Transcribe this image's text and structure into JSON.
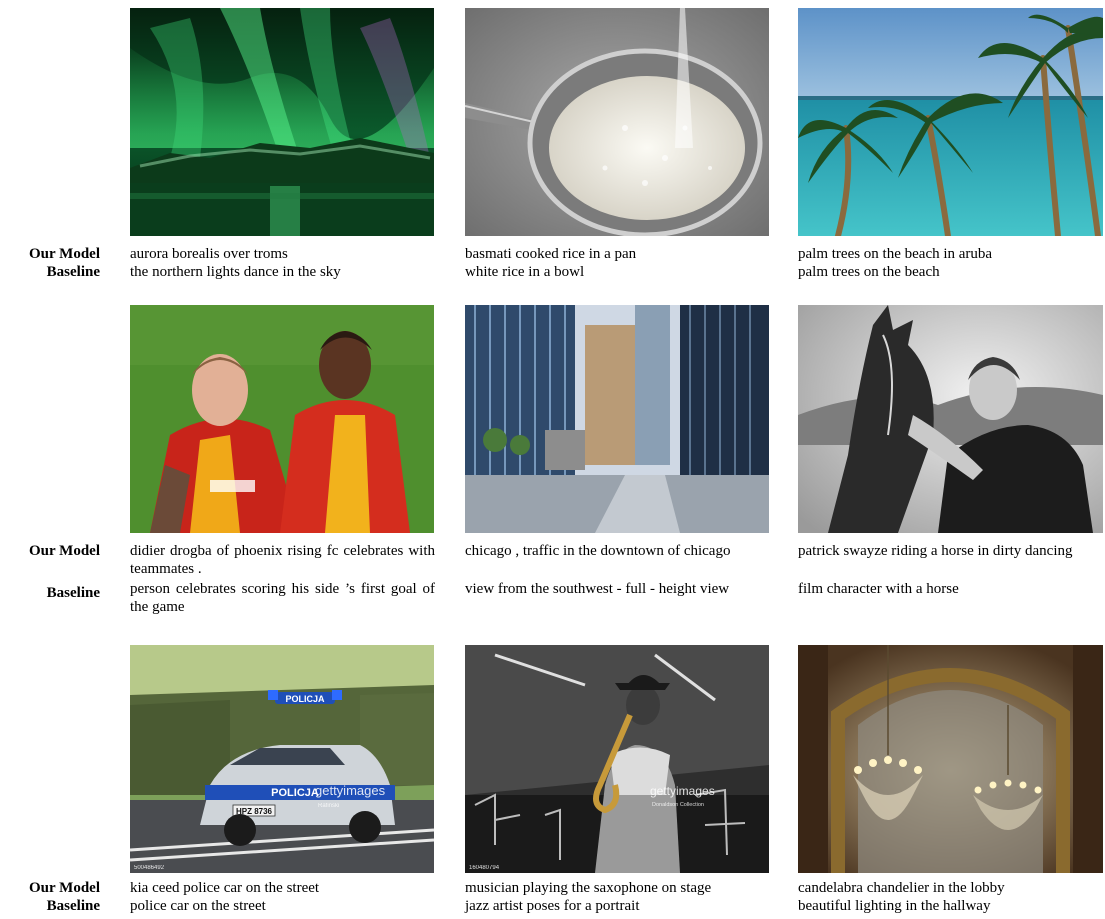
{
  "labels": {
    "ours": "Our Model",
    "baseline": "Baseline"
  },
  "rows": [
    {
      "cells": [
        {
          "image": "aurora-borealis-photo",
          "ours": "aurora borealis over troms",
          "baseline": "the northern lights dance in the sky"
        },
        {
          "image": "rice-strainer-photo",
          "ours": "basmati cooked rice in a pan",
          "baseline": "white rice in a bowl"
        },
        {
          "image": "palm-trees-photo",
          "ours": "palm trees on the beach in aruba",
          "baseline": "palm trees on the beach"
        }
      ]
    },
    {
      "cells": [
        {
          "image": "soccer-players-photo",
          "ours": "didier drogba of phoenix rising fc celebrates with teammates .",
          "baseline": "person celebrates scoring his side ’s first goal of the game"
        },
        {
          "image": "chicago-street-photo",
          "ours": "chicago , traffic in the downtown of chicago",
          "baseline": "view from the southwest - full - height view"
        },
        {
          "image": "man-with-horse-photo",
          "ours": "patrick swayze riding a horse in dirty dancing",
          "baseline": "film character with a horse"
        }
      ]
    },
    {
      "cells": [
        {
          "image": "police-car-photo",
          "ours": "kia ceed police car on the street",
          "baseline": "police car on the street",
          "image_text": {
            "roof": "POLICJA",
            "door": "POLICJA",
            "plate": "HPZ 8736",
            "watermark": "gettyimages",
            "credit": "Rafinski",
            "id": "500486492"
          }
        },
        {
          "image": "saxophone-musician-photo",
          "ours": "musician playing the saxophone on stage",
          "baseline": "jazz artist poses for a portrait",
          "image_text": {
            "watermark": "gettyimages",
            "credit": "Donaldson Collection",
            "id": "160480794"
          }
        },
        {
          "image": "chandelier-hallway-photo",
          "ours": "candelabra chandelier in the lobby",
          "baseline": "beautiful lighting in the hallway"
        }
      ]
    }
  ]
}
